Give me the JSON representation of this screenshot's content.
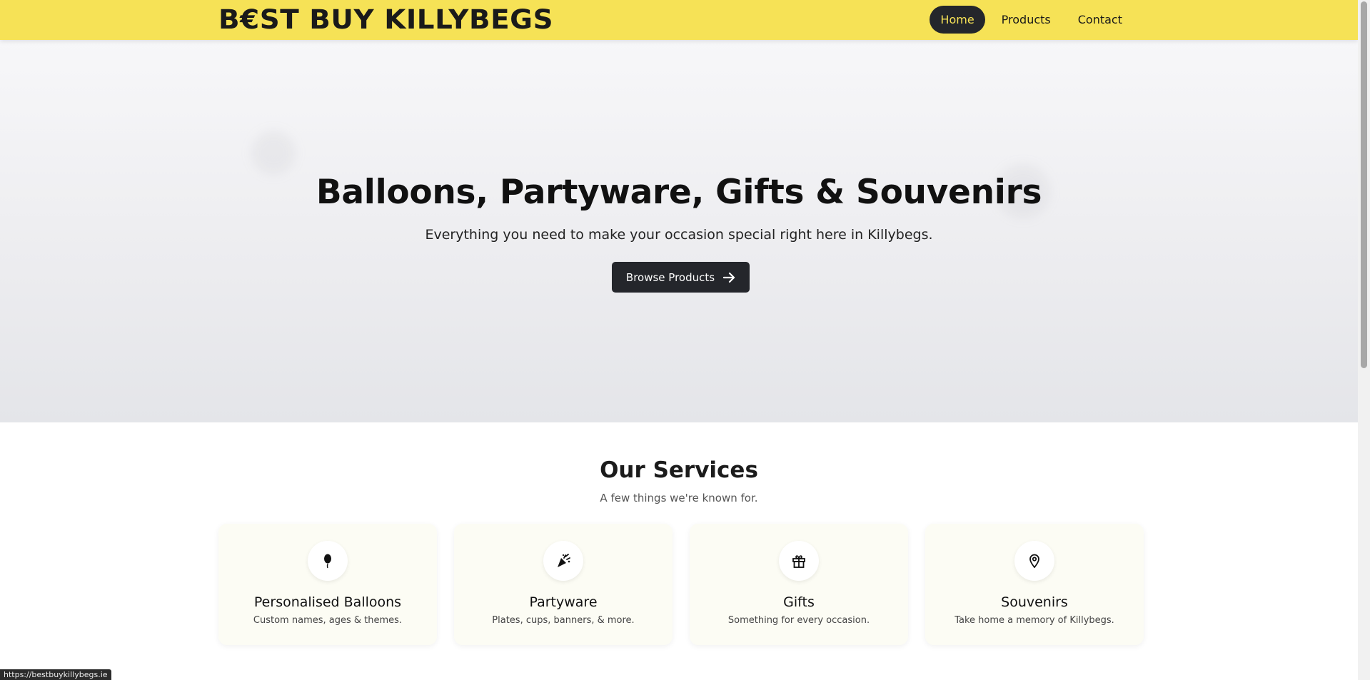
{
  "navbar": {
    "brand": "B€ST BUY KILLYBEGS",
    "links": [
      {
        "label": "Home",
        "active": true
      },
      {
        "label": "Products",
        "active": false
      },
      {
        "label": "Contact",
        "active": false
      }
    ]
  },
  "hero": {
    "title": "Balloons, Partyware, Gifts & Souvenirs",
    "subtitle": "Everything you need to make your occasion special right here in Killybegs.",
    "button_label": "Browse Products",
    "button_icon": "arrow-right-icon"
  },
  "services": {
    "title": "Our Services",
    "subtitle": "A few things we're known for.",
    "cards": [
      {
        "icon": "balloon-icon",
        "title": "Personalised Balloons",
        "description": "Custom names, ages & themes."
      },
      {
        "icon": "party-popper-icon",
        "title": "Partyware",
        "description": "Plates, cups, banners, & more."
      },
      {
        "icon": "gift-icon",
        "title": "Gifts",
        "description": "Something for every occasion."
      },
      {
        "icon": "map-pin-icon",
        "title": "Souvenirs",
        "description": "Take home a memory of Killybegs."
      }
    ]
  },
  "status_url": "https://bestbuykillybegs.ie",
  "colors": {
    "navbar_bg": "#f6e256",
    "dark": "#24262b",
    "active_link_text": "#f6e256",
    "card_bg": "#fcfcf4"
  }
}
